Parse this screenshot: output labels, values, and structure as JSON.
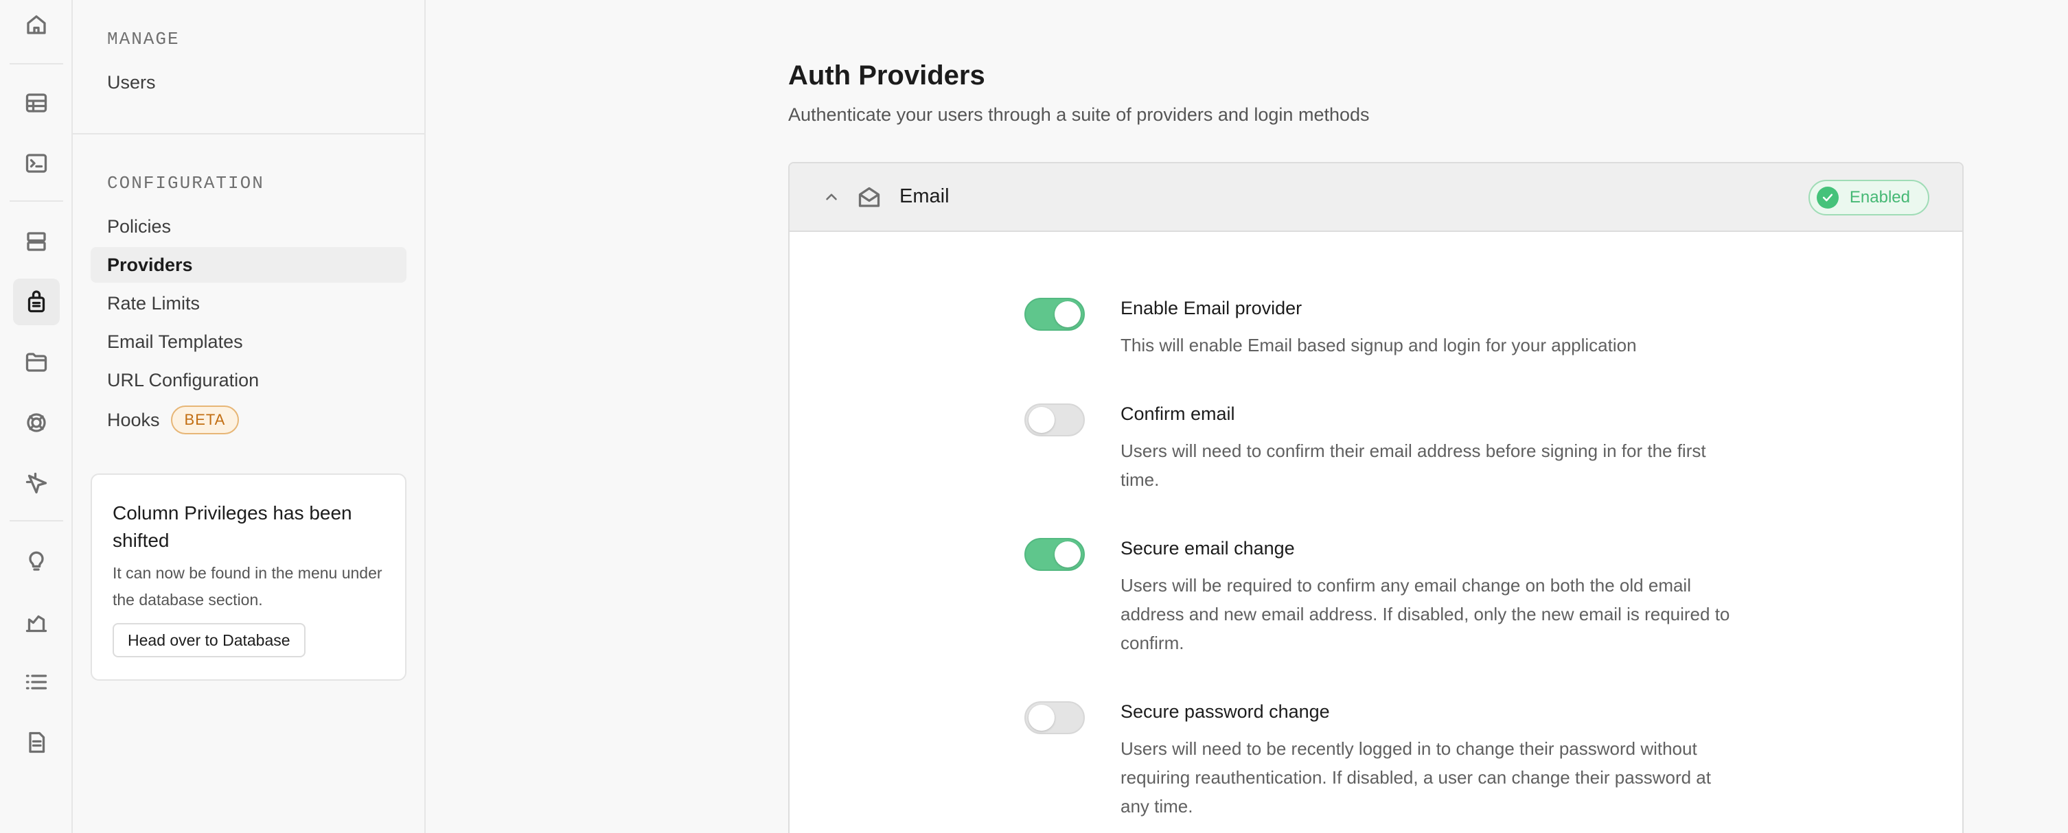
{
  "rail": {
    "items": [
      {
        "icon": "home-icon"
      },
      {
        "icon": "table-editor-icon"
      },
      {
        "icon": "sql-editor-icon"
      },
      {
        "icon": "database-icon"
      },
      {
        "icon": "authentication-icon"
      },
      {
        "icon": "storage-icon"
      },
      {
        "icon": "realtime-icon"
      },
      {
        "icon": "edge-functions-icon"
      },
      {
        "icon": "advisors-icon"
      },
      {
        "icon": "reports-icon"
      },
      {
        "icon": "logs-icon"
      },
      {
        "icon": "api-docs-icon"
      }
    ],
    "active": "authentication-icon"
  },
  "sidebar": {
    "manage_title": "MANAGE",
    "manage_items": [
      {
        "label": "Users"
      }
    ],
    "config_title": "CONFIGURATION",
    "config_items": [
      {
        "label": "Policies"
      },
      {
        "label": "Providers",
        "active": true
      },
      {
        "label": "Rate Limits"
      },
      {
        "label": "Email Templates"
      },
      {
        "label": "URL Configuration"
      },
      {
        "label": "Hooks",
        "badge": "BETA"
      }
    ],
    "callout": {
      "title": "Column Privileges has been shifted",
      "body": "It can now be found in the menu under the database section.",
      "button": "Head over to Database"
    }
  },
  "main": {
    "title": "Auth Providers",
    "subtitle": "Authenticate your users through a suite of providers and login methods",
    "provider": {
      "name": "Email",
      "status": "Enabled",
      "status_color": "#45b874",
      "settings": [
        {
          "label": "Enable Email provider",
          "description": "This will enable Email based signup and login for your application",
          "enabled": true
        },
        {
          "label": "Confirm email",
          "description": "Users will need to confirm their email address before signing in for the first time.",
          "enabled": false
        },
        {
          "label": "Secure email change",
          "description": "Users will be required to confirm any email change on both the old email address and new email address. If disabled, only the new email is required to confirm.",
          "enabled": true
        },
        {
          "label": "Secure password change",
          "description": "Users will need to be recently logged in to change their password without requiring reauthentication. If disabled, a user can change their password at any time.",
          "enabled": false
        }
      ]
    }
  },
  "colors": {
    "accent_green": "#5fc68c",
    "beta_orange": "#c26e12"
  }
}
